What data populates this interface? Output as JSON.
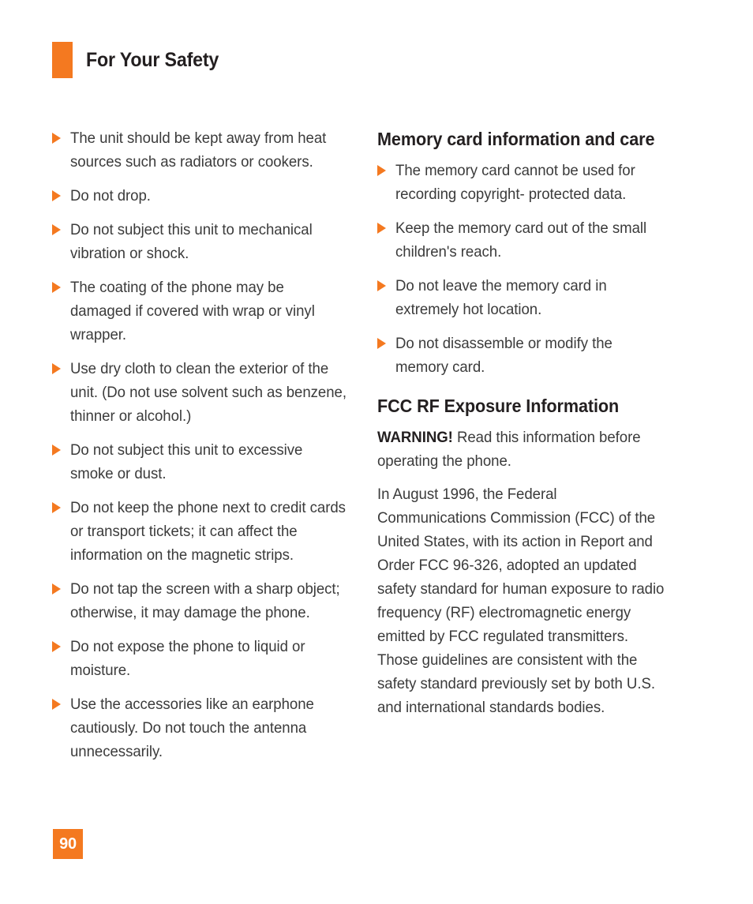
{
  "header": {
    "title": "For Your Safety",
    "accent_color": "#f47920"
  },
  "left_column": {
    "bullets": [
      "The unit should be kept away from heat sources such as radiators or cookers.",
      "Do not drop.",
      "Do not subject this unit to mechanical vibration or shock.",
      "The coating of the phone may be damaged if covered with wrap or vinyl wrapper.",
      "Use dry cloth to clean the exterior of the unit. (Do not use solvent such as benzene, thinner or alcohol.)",
      "Do not subject this unit to excessive smoke or dust.",
      "Do not keep the phone next to credit cards or transport tickets; it can affect the information on the magnetic strips.",
      "Do not tap the screen with a sharp object; otherwise, it may damage the phone.",
      "Do not expose the phone to liquid or moisture.",
      "Use the accessories like an earphone cautiously. Do not touch the antenna unnecessarily."
    ]
  },
  "right_column": {
    "memory_card": {
      "heading": "Memory card information and care",
      "bullets": [
        "The memory card cannot be used for recording copyright- protected data.",
        "Keep the memory card out of the small children's reach.",
        "Do not leave the memory card in extremely hot location.",
        "Do not disassemble or modify the memory card."
      ]
    },
    "fcc": {
      "heading": "FCC RF Exposure Information",
      "warning_label": "WARNING!",
      "warning_text": " Read this information before operating the phone.",
      "paragraph": "In August 1996, the Federal Communications Commission (FCC) of the United States, with its action in Report and Order FCC 96-326, adopted an updated safety standard for human exposure to radio frequency (RF) electromagnetic energy emitted by FCC regulated transmitters. Those guidelines are consistent with the safety standard previously set by both U.S. and international standards bodies."
    }
  },
  "footer": {
    "page_number": "90"
  }
}
